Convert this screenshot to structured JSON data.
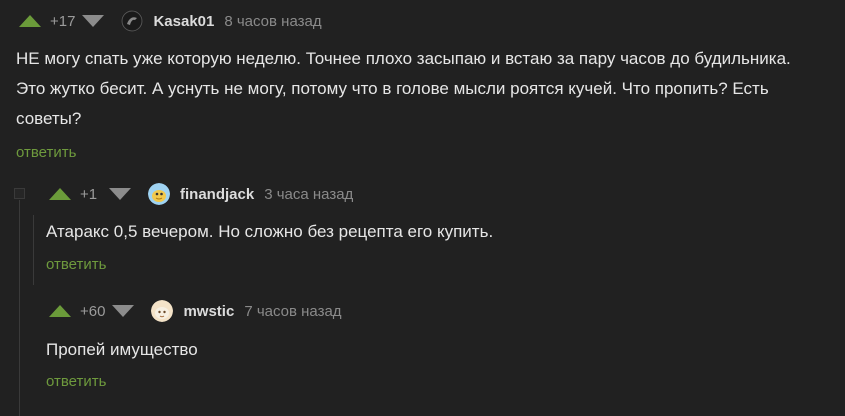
{
  "comments": [
    {
      "rating": "+17",
      "author": "Kasak01",
      "time": "8 часов назад",
      "text_lines": [
        "НЕ могу спать уже которую неделю. Точнее плохо засыпаю и встаю за пару часов до будильника.",
        "Это жутко бесит. А уснуть не могу, потому что в голове мысли роятся кучей. Что пропить? Есть",
        "советы?"
      ],
      "reply": "ответить"
    },
    {
      "rating": "+1",
      "author": "finandjack",
      "time": "3 часа назад",
      "text_lines": [
        "Атаракс 0,5 вечером. Но сложно без рецепта его купить."
      ],
      "reply": "ответить"
    },
    {
      "rating": "+60",
      "author": "mwstic",
      "time": "7 часов назад",
      "text_lines": [
        "Пропей имущество"
      ],
      "reply": "ответить"
    }
  ],
  "colors": {
    "background": "#212121",
    "vote_up": "#6b9b3a",
    "vote_down": "#8c8c8c",
    "reply_link": "#6e9a3d"
  },
  "icons": {
    "vote_up": "triangle-up-icon",
    "vote_down": "triangle-down-icon"
  }
}
